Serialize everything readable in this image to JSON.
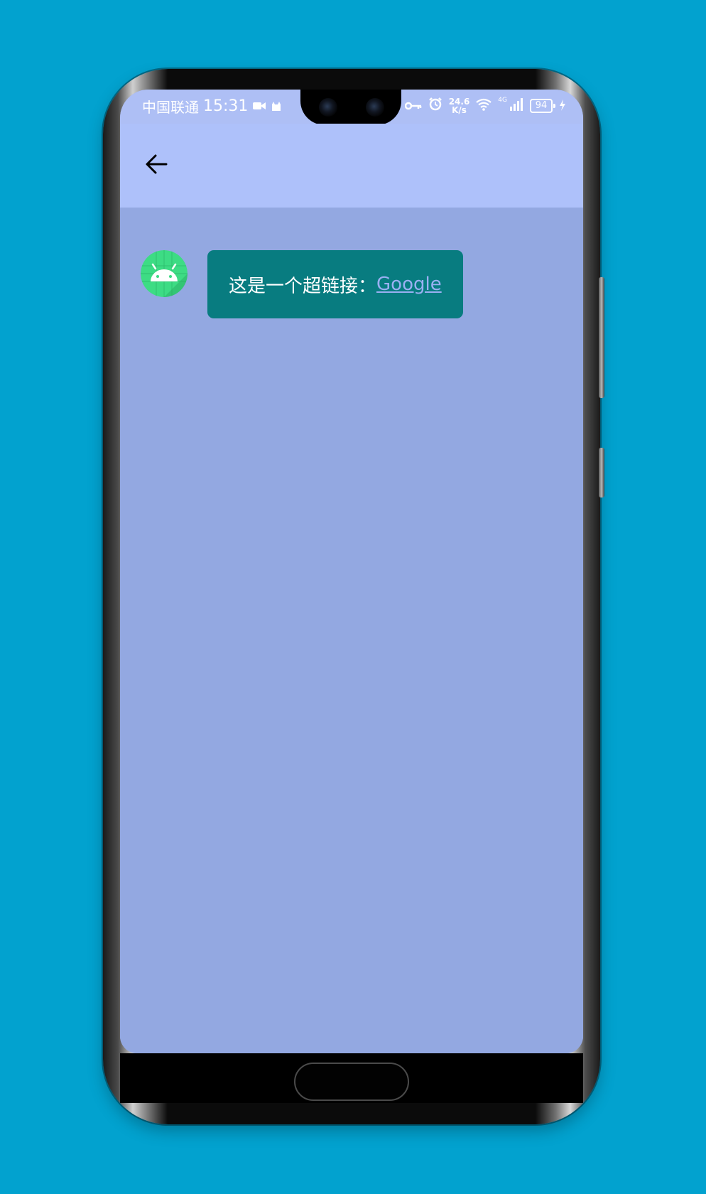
{
  "status_bar": {
    "carrier": "中国联通",
    "time": "15:31",
    "net_speed_value": "24.6",
    "net_speed_unit": "K/s",
    "network_type": "4G",
    "battery": "94"
  },
  "app_bar": {
    "back_icon": "arrow-left-icon"
  },
  "message": {
    "avatar_icon": "android-robot-icon",
    "text": "这是一个超链接：",
    "link_text": "Google"
  },
  "colors": {
    "background": "#02a2cf",
    "app_bar": "#aec1fa",
    "content_bg": "#93a8e1",
    "bubble": "#087c80",
    "link": "#9ab0f2",
    "avatar_bg": "#3ddc84"
  }
}
